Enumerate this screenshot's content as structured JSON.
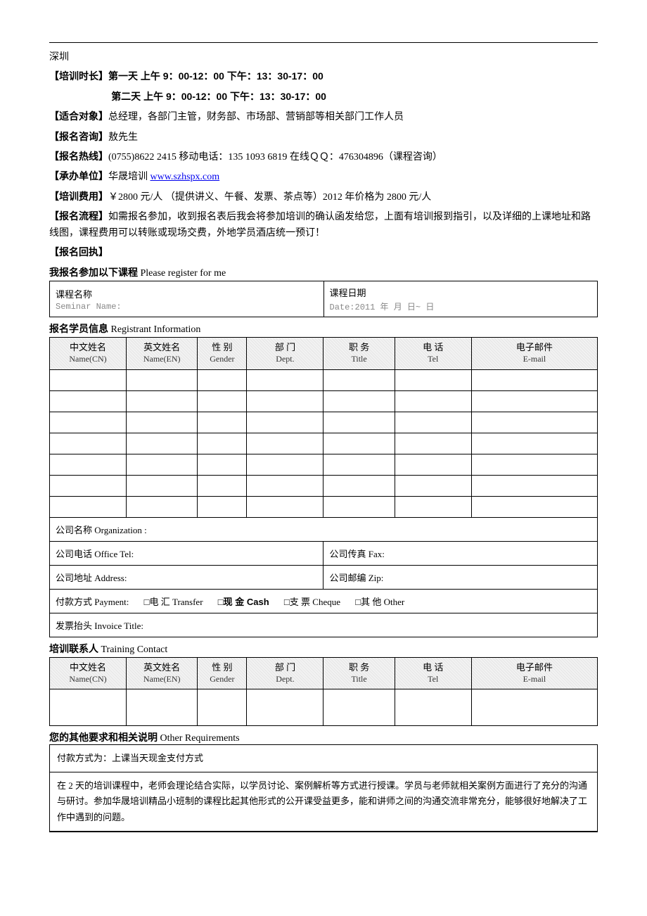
{
  "top_location": "深圳",
  "fields": {
    "duration_label": "【培训时长】",
    "duration_day1": "第一天 上午 9：00-12：00   下午：13：30-17：00",
    "duration_day2": "第二天 上午 9：00-12：00   下午：13：30-17：00",
    "audience_label": "【适合对象】",
    "audience_text": "总经理，各部门主管，财务部、市场部、营销部等相关部门工作人员",
    "consult_label": "【报名咨询】",
    "consult_text": "敖先生",
    "hotline_label": "【报名热线】",
    "hotline_text": "(0755)8622 2415   移动电话：135 1093 6819   在线ＱＱ：476304896（课程咨询）",
    "organizer_label": "【承办单位】",
    "organizer_text": "华晟培训  ",
    "organizer_link": "www.szhspx.com",
    "fee_label": "【培训费用】",
    "fee_text": "￥2800 元/人  （提供讲义、午餐、发票、茶点等）2012 年价格为 2800 元/人",
    "process_label": "【报名流程】",
    "process_text": "如需报名参加，收到报名表后我会将参加培训的确认函发给您，上面有培训报到指引，以及详细的上课地址和路线图，课程费用可以转账或现场交费，外地学员酒店统一预订！",
    "receipt_label": "【报名回执】"
  },
  "register_title_cn": "我报名参加以下课程",
  "register_title_en": "  Please register for me",
  "seminar": {
    "name_label": "课程名称",
    "name_sub": "Seminar Name:",
    "date_label": "课程日期",
    "date_sub": "Date:2011 年   月   日~   日"
  },
  "registrant_title_cn": "报名学员信息",
  "registrant_title_en": "  Registrant Information",
  "cols": {
    "name_cn": "中文姓名",
    "name_cn_sub": "Name(CN)",
    "name_en": "英文姓名",
    "name_en_sub": "Name(EN)",
    "gender": "性  别",
    "gender_sub": "Gender",
    "dept": "部  门",
    "dept_sub": "Dept.",
    "title": "职  务",
    "title_sub": "Title",
    "tel": "电  话",
    "tel_sub": "Tel",
    "email": "电子邮件",
    "email_sub": "E-mail"
  },
  "company": {
    "org": "公司名称 Organization :",
    "tel": "公司电话 Office Tel:",
    "fax": "公司传真 Fax:",
    "addr": "公司地址 Address:",
    "zip": "公司邮编 Zip:",
    "payment_label": "付款方式 Payment:",
    "pay_transfer": "□电  汇 Transfer",
    "pay_cash": "□现  金 Cash",
    "pay_cheque": "□支  票 Cheque",
    "pay_other": "□其  他 Other",
    "invoice": "发票抬头 Invoice Title:"
  },
  "contact_title_cn": "培训联系人",
  "contact_title_en": " Training Contact",
  "other_req_title_cn": "您的其他要求和相关说明",
  "other_req_title_en": "  Other Requirements",
  "req_payment_note": "付款方式为：上课当天现金支付方式",
  "req_desc": "在 2 天的培训课程中，老师会理论结合实际，以学员讨论、案例解析等方式进行授课。学员与老师就相关案例方面进行了充分的沟通与研讨。参加华晟培训精品小班制的课程比起其他形式的公开课受益更多，能和讲师之间的沟通交流非常充分，能够很好地解决了工作中遇到的问题。"
}
